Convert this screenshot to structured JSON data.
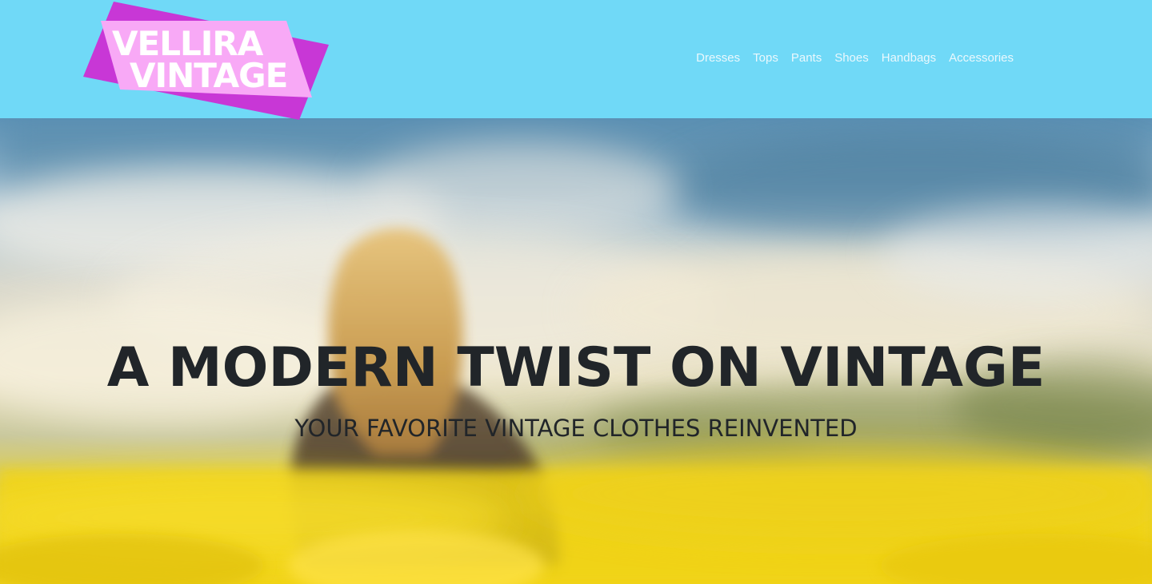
{
  "header": {
    "logo": {
      "line1": "VELLIRA",
      "line2": "VINTAGE"
    },
    "nav": [
      {
        "label": "Dresses"
      },
      {
        "label": "Tops"
      },
      {
        "label": "Pants"
      },
      {
        "label": "Shoes"
      },
      {
        "label": "Handbags"
      },
      {
        "label": "Accessories"
      }
    ]
  },
  "hero": {
    "title": "A MODERN TWIST ON VINTAGE",
    "subtitle": "YOUR FAVORITE VINTAGE CLOTHES REINVENTED"
  },
  "colors": {
    "header_bg": "#70d9f7",
    "logo_magenta": "#c837d6",
    "logo_pink": "#f8a9f6",
    "hero_text": "#212529",
    "nav_text": "#eaf8fd"
  }
}
